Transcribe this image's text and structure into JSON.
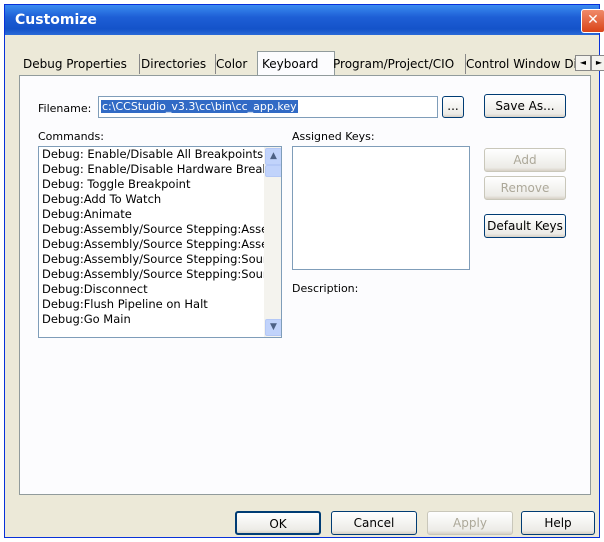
{
  "window": {
    "title": "Customize",
    "close_glyph": "✕"
  },
  "tabs": [
    {
      "label": "Debug Properties"
    },
    {
      "label": "Directories"
    },
    {
      "label": "Color"
    },
    {
      "label": "Keyboard"
    },
    {
      "label": "Program/Project/CIO"
    },
    {
      "label": "Control Window Di"
    }
  ],
  "tab_scroll": {
    "left": "◄",
    "right": "►"
  },
  "filename": {
    "label": "Filename:",
    "value": "c:\\CCStudio_v3.3\\cc\\bin\\cc_app.key",
    "browse_label": "...",
    "save_as_label": "Save As..."
  },
  "commands": {
    "label": "Commands:",
    "items": [
      "Debug: Enable/Disable All Breakpoints",
      "Debug: Enable/Disable Hardware Breal",
      "Debug: Toggle Breakpoint",
      "Debug:Add To Watch",
      "Debug:Animate",
      "Debug:Assembly/Source Stepping:Asse",
      "Debug:Assembly/Source Stepping:Asse",
      "Debug:Assembly/Source Stepping:Sour",
      "Debug:Assembly/Source Stepping:Sour",
      "Debug:Disconnect",
      "Debug:Flush Pipeline on Halt",
      "Debug:Go Main"
    ],
    "scroll_up": "▲",
    "scroll_down": "▼"
  },
  "assigned_keys": {
    "label": "Assigned Keys:"
  },
  "buttons": {
    "add": "Add",
    "remove": "Remove",
    "default_keys": "Default Keys"
  },
  "description": {
    "label": "Description:"
  },
  "footer": {
    "ok": "OK",
    "cancel": "Cancel",
    "apply": "Apply",
    "help": "Help"
  }
}
